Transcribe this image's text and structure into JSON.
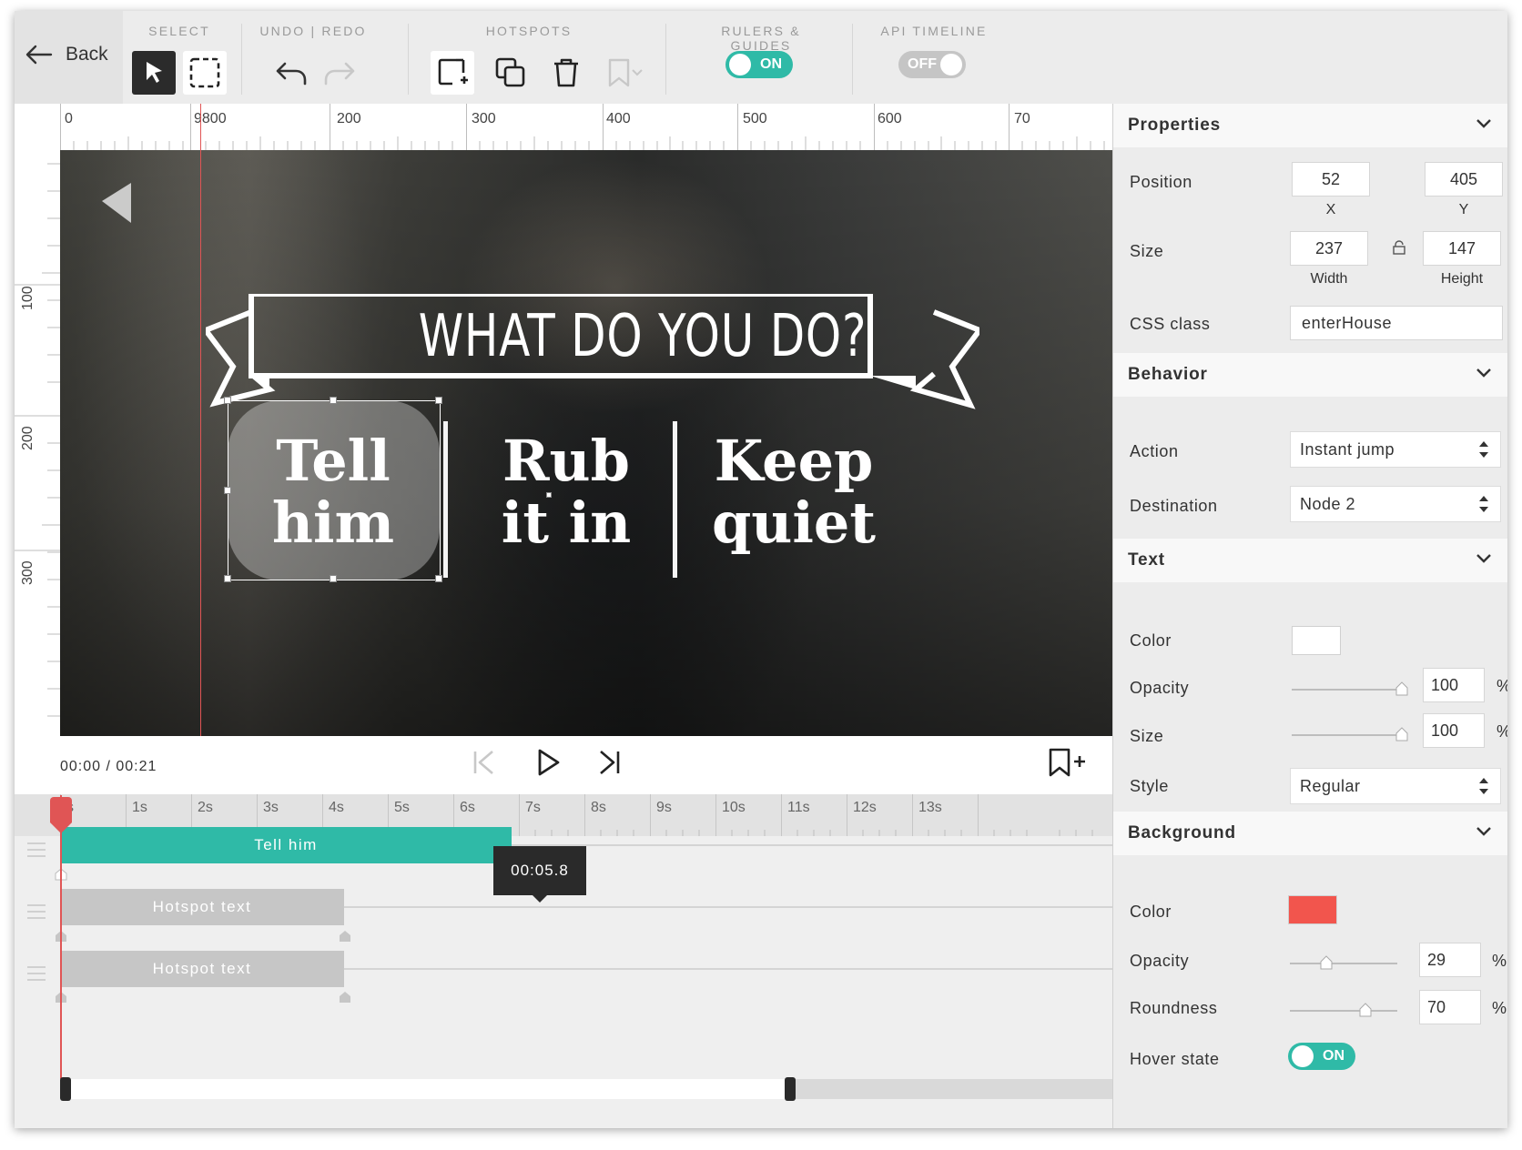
{
  "toolbar": {
    "back_label": "Back",
    "groups": {
      "select": "SELECT",
      "undo_redo": "UNDO | REDO",
      "hotspots": "HOTSPOTS",
      "rulers_guides": "RULERS & GUIDES",
      "api_timeline": "API TIMELINE"
    },
    "rulers_toggle": {
      "label": "ON",
      "state": "on"
    },
    "api_toggle": {
      "label": "OFF",
      "state": "off"
    }
  },
  "ruler_top": {
    "labels": [
      "0",
      "9800",
      "200",
      "300",
      "400",
      "500",
      "600",
      "70"
    ]
  },
  "ruler_left": {
    "labels": [
      "100",
      "200",
      "300"
    ]
  },
  "video": {
    "banner_title": "WHAT DO YOU DO?",
    "choices": [
      {
        "line1": "Tell",
        "line2": "him"
      },
      {
        "line1": "Rub",
        "line2": "it in"
      },
      {
        "line1": "Keep",
        "line2": "quiet"
      }
    ]
  },
  "playback": {
    "timecode": "00:00 / 00:21"
  },
  "timeline": {
    "seconds": [
      "s",
      "1s",
      "2s",
      "3s",
      "4s",
      "5s",
      "6s",
      "7s",
      "8s",
      "9s",
      "10s",
      "11s",
      "12s",
      "13s"
    ],
    "tooltip": "00:05.8",
    "tracks": [
      {
        "label": "Tell him",
        "style": "teal"
      },
      {
        "label": "Hotspot text",
        "style": "grey"
      },
      {
        "label": "Hotspot text",
        "style": "grey"
      }
    ]
  },
  "panel": {
    "properties": {
      "title": "Properties",
      "position_label": "Position",
      "x_value": "52",
      "y_value": "405",
      "x_label": "X",
      "y_label": "Y",
      "size_label": "Size",
      "width_value": "237",
      "height_value": "147",
      "width_label": "Width",
      "height_label": "Height",
      "css_label": "CSS class",
      "css_value": "enterHouse"
    },
    "behavior": {
      "title": "Behavior",
      "action_label": "Action",
      "action_value": "Instant jump",
      "destination_label": "Destination",
      "destination_value": "Node 2"
    },
    "text": {
      "title": "Text",
      "color_label": "Color",
      "color_value": "#ffffff",
      "opacity_label": "Opacity",
      "opacity_value": "100",
      "size_label": "Size",
      "size_value": "100",
      "style_label": "Style",
      "style_value": "Regular",
      "pct": "%"
    },
    "background": {
      "title": "Background",
      "color_label": "Color",
      "color_value": "#f2554d",
      "opacity_label": "Opacity",
      "opacity_value": "29",
      "roundness_label": "Roundness",
      "roundness_value": "70",
      "hover_label": "Hover state",
      "hover_toggle": {
        "label": "ON",
        "state": "on"
      },
      "pct": "%"
    }
  },
  "colors": {
    "accent_teal": "#2fbaa7",
    "playhead_red": "#e05555",
    "bg_swatch": "#f2554d"
  }
}
